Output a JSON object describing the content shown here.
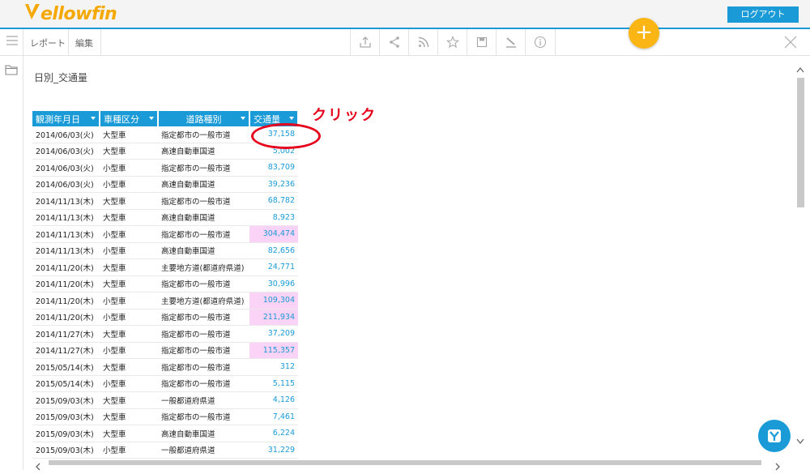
{
  "header": {
    "logo_text": "ellowfin",
    "logout_label": "ログアウト"
  },
  "toolbar": {
    "report_label": "レポート",
    "edit_label": "編集",
    "icons": [
      "export-icon",
      "share-icon",
      "rss-icon",
      "star-icon",
      "save-icon",
      "brush-icon",
      "info-icon"
    ],
    "add_symbol": "+"
  },
  "report": {
    "title": "日別_交通量",
    "columns": [
      "観測年月日",
      "車種区分",
      "道路種別",
      "交通量"
    ],
    "rows": [
      [
        "2014/06/03(火)",
        "大型車",
        "指定都市の一般市道",
        "37,158",
        false
      ],
      [
        "2014/06/03(火)",
        "大型車",
        "高速自動車国道",
        "5,002",
        false
      ],
      [
        "2014/06/03(火)",
        "小型車",
        "指定都市の一般市道",
        "83,709",
        false
      ],
      [
        "2014/06/03(火)",
        "小型車",
        "高速自動車国道",
        "39,236",
        false
      ],
      [
        "2014/11/13(木)",
        "大型車",
        "指定都市の一般市道",
        "68,782",
        false
      ],
      [
        "2014/11/13(木)",
        "大型車",
        "高速自動車国道",
        "8,923",
        false
      ],
      [
        "2014/11/13(木)",
        "小型車",
        "指定都市の一般市道",
        "304,474",
        true
      ],
      [
        "2014/11/13(木)",
        "小型車",
        "高速自動車国道",
        "82,656",
        false
      ],
      [
        "2014/11/20(木)",
        "大型車",
        "主要地方道(都道府県道)",
        "24,771",
        false
      ],
      [
        "2014/11/20(木)",
        "大型車",
        "指定都市の一般市道",
        "30,996",
        false
      ],
      [
        "2014/11/20(木)",
        "小型車",
        "主要地方道(都道府県道)",
        "109,304",
        true
      ],
      [
        "2014/11/20(木)",
        "小型車",
        "指定都市の一般市道",
        "211,934",
        true
      ],
      [
        "2014/11/27(木)",
        "大型車",
        "指定都市の一般市道",
        "37,209",
        false
      ],
      [
        "2014/11/27(木)",
        "小型車",
        "指定都市の一般市道",
        "115,357",
        true
      ],
      [
        "2015/05/14(木)",
        "大型車",
        "指定都市の一般市道",
        "312",
        false
      ],
      [
        "2015/05/14(木)",
        "小型車",
        "指定都市の一般市道",
        "5,115",
        false
      ],
      [
        "2015/09/03(木)",
        "大型車",
        "一般都道府県道",
        "4,126",
        false
      ],
      [
        "2015/09/03(木)",
        "大型車",
        "指定都市の一般市道",
        "7,461",
        false
      ],
      [
        "2015/09/03(木)",
        "大型車",
        "高速自動車国道",
        "6,224",
        false
      ],
      [
        "2015/09/03(木)",
        "小型車",
        "一般都道府県道",
        "31,229",
        false
      ]
    ]
  },
  "annotation": {
    "text": "クリック"
  },
  "colors": {
    "accent": "#1a9bd7",
    "brand": "#f5a800",
    "add_button": "#fbb616",
    "highlight": "#fbd3f7",
    "annotation": "#e6001b"
  }
}
